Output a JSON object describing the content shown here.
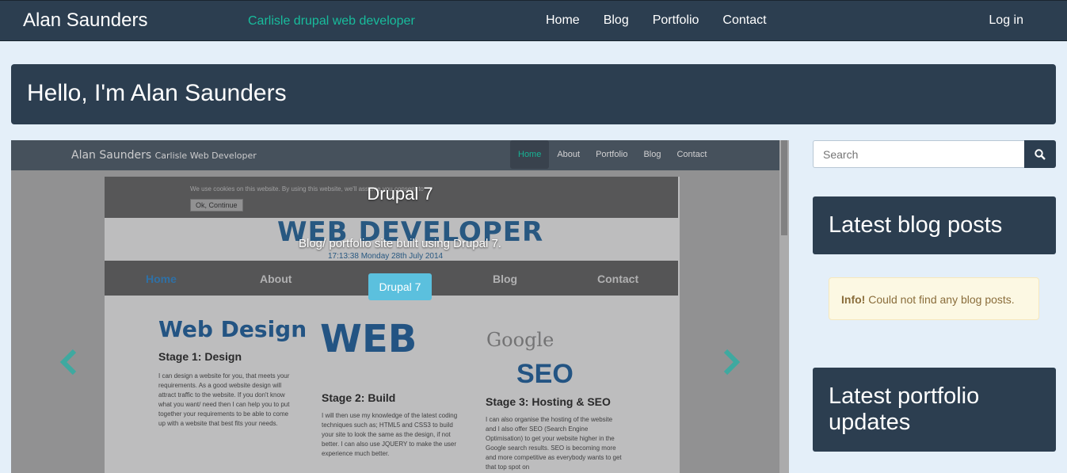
{
  "navbar": {
    "brand": "Alan Saunders",
    "tagline": "Carlisle drupal web developer",
    "links": [
      "Home",
      "Blog",
      "Portfolio",
      "Contact"
    ],
    "login": "Log in"
  },
  "hero": {
    "title": "Hello, I'm Alan Saunders"
  },
  "carousel": {
    "slide_title": "Drupal 7",
    "slide_text": "Blog/ portfolio site built using Drupal 7.",
    "slide_button": "Drupal 7",
    "screenshot": {
      "brand": "Alan Saunders",
      "brand_sub": "Carlisle Web Developer",
      "nav": [
        "Home",
        "About",
        "Portfolio",
        "Blog",
        "Contact"
      ],
      "cookie_text": "We use cookies on this website. By using this website, we'll assume you consent to",
      "cookie_button": "Ok, Continue",
      "banner": "WEB DEVELOPER",
      "date": "17:13:38 Monday 28th July 2014",
      "menu": [
        "Home",
        "About",
        "Blog",
        "Contact"
      ],
      "web_design": "Web Design",
      "web": "WEB",
      "google": "Google",
      "seo": "SEO",
      "stage1_title": "Stage 1: Design",
      "stage1_text": "I can design a website for you, that meets your requirements. As a good website design will attract traffic to the website. If you don't know what you want/ need then I can help you to put together your requirements to be able to come up with a website that best fits your needs.",
      "stage2_title": "Stage 2: Build",
      "stage2_text": "I will then use my knowledge of the latest coding techniques such as; HTML5 and CSS3 to build your site to look the same as the design, if not better. I can also use JQUERY to make the user experience much better.",
      "stage3_title": "Stage 3: Hosting & SEO",
      "stage3_text": "I can also organise the hosting of the website and I also offer SEO (Search Engine Optimisation) to get your website higher in the Google search results. SEO is becoming more and more competitive as everybody wants to get that top spot on"
    }
  },
  "sidebar": {
    "search_placeholder": "Search",
    "blog_title": "Latest blog posts",
    "alert_strong": "Info!",
    "alert_text": " Could not find any blog posts.",
    "portfolio_title": "Latest portfolio updates"
  },
  "colors": {
    "primary": "#2c3e50",
    "accent": "#18bc9c",
    "info": "#5bc0de",
    "background": "#e4eff9"
  }
}
